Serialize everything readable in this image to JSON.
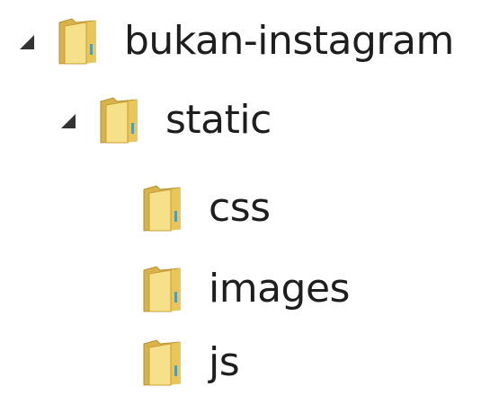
{
  "tree": {
    "root": {
      "label": "bukan-instagram",
      "expanded": true,
      "icon": "folder-icon",
      "children": {
        "static": {
          "label": "static",
          "expanded": true,
          "icon": "folder-icon",
          "children": [
            {
              "label": "css",
              "icon": "folder-icon"
            },
            {
              "label": "images",
              "icon": "folder-icon"
            },
            {
              "label": "js",
              "icon": "folder-icon"
            }
          ]
        }
      }
    }
  },
  "colors": {
    "folder_back": "#d9b24a",
    "folder_front": "#f3d97a",
    "folder_edge": "#b8902e",
    "accent_stripe": "#3aa0d8",
    "expander": "#333333",
    "text": "#1e1e1e"
  }
}
